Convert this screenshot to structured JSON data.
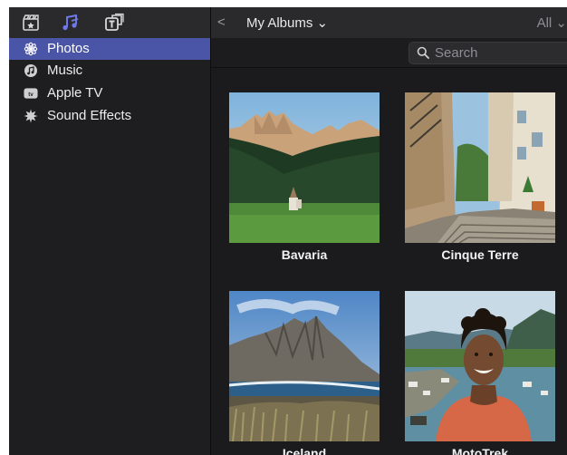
{
  "toolbar": {
    "back_glyph": "<",
    "album_title": "My Albums ⌄",
    "all_label": "All ⌄",
    "icons": [
      "media-clapper-icon",
      "music-notes-icon",
      "titles-icon"
    ]
  },
  "sidebar": {
    "items": [
      {
        "label": "Photos",
        "icon": "photos-flower-icon",
        "selected": true
      },
      {
        "label": "Music",
        "icon": "music-icon",
        "selected": false
      },
      {
        "label": "Apple TV",
        "icon": "apple-tv-icon",
        "selected": false
      },
      {
        "label": "Sound Effects",
        "icon": "sound-effects-icon",
        "selected": false
      }
    ]
  },
  "search": {
    "placeholder": "Search",
    "value": ""
  },
  "albums": [
    {
      "name": "Bavaria"
    },
    {
      "name": "Cinque Terre"
    },
    {
      "name": "Iceland"
    },
    {
      "name": "MotoTrek"
    }
  ],
  "colors": {
    "accent": "#4b55a8",
    "background": "#1c1c1e",
    "toolbar": "#2a2a2c"
  }
}
